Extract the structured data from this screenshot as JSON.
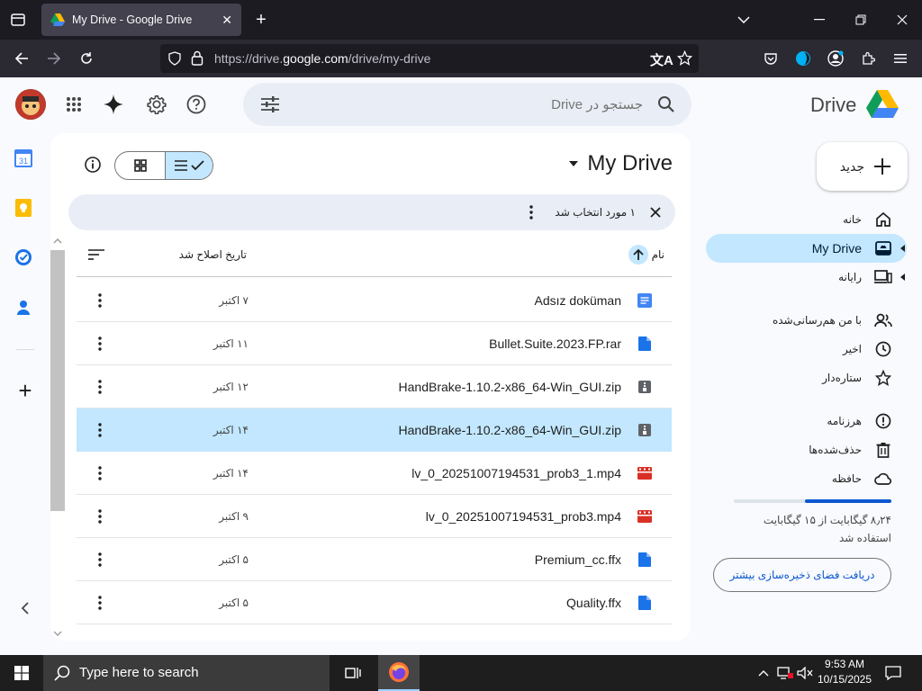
{
  "browser": {
    "tab_title": "My Drive - Google Drive",
    "url_prefix": "https://drive.",
    "url_domain": "google.com",
    "url_path": "/drive/my-drive"
  },
  "drive": {
    "logo_text": "Drive",
    "search_placeholder": "جستجو در Drive",
    "new_button": "جدید",
    "title": "My Drive",
    "selection_text": "۱ مورد انتخاب شد",
    "col_name": "نام",
    "col_modified": "تاریخ اصلاح شد",
    "nav": [
      {
        "label": "خانه",
        "icon": "home-icon"
      },
      {
        "label": "My Drive",
        "icon": "my-drive-icon"
      },
      {
        "label": "رایانه",
        "icon": "computer-icon"
      },
      {
        "label": "با من هم‌رسانی‌شده",
        "icon": "shared-icon"
      },
      {
        "label": "اخیر",
        "icon": "recent-icon"
      },
      {
        "label": "ستاره‌دار",
        "icon": "star-icon"
      },
      {
        "label": "هرزنامه",
        "icon": "spam-icon"
      },
      {
        "label": "حذف‌شده‌ها",
        "icon": "trash-icon"
      },
      {
        "label": "حافظه",
        "icon": "cloud-icon"
      }
    ],
    "storage_text": "۸٫۲۴ گیگابایت از ۱۵ گیگابایت استفاده شد",
    "storage_used_fraction": 0.55,
    "storage_button": "دریافت فضای ذخیره‌سازی بیشتر",
    "files": [
      {
        "name": "Adsız doküman",
        "date": "۷ اکتبر",
        "type": "doc"
      },
      {
        "name": "Bullet.Suite.2023.FP.rar",
        "date": "۱۱ اکتبر",
        "type": "file"
      },
      {
        "name": "HandBrake-1.10.2-x86_64-Win_GUI.zip",
        "date": "۱۲ اکتبر",
        "type": "zip"
      },
      {
        "name": "HandBrake-1.10.2-x86_64-Win_GUI.zip",
        "date": "۱۴ اکتبر",
        "type": "zip",
        "selected": true
      },
      {
        "name": "lv_0_20251007194531_prob3_1.mp4",
        "date": "۱۴ اکتبر",
        "type": "video"
      },
      {
        "name": "lv_0_20251007194531_prob3.mp4",
        "date": "۹ اکتبر",
        "type": "video"
      },
      {
        "name": "Premium_cc.ffx",
        "date": "۵ اکتبر",
        "type": "file"
      },
      {
        "name": "Quality.ffx",
        "date": "۵ اکتبر",
        "type": "file"
      }
    ]
  },
  "taskbar": {
    "search_placeholder": "Type here to search",
    "time": "9:53 AM",
    "date": "10/15/2025"
  },
  "colors": {
    "accent": "#0b57d0",
    "selected_row": "#c2e7ff",
    "nav_active": "#c2e7ff",
    "video_red": "#d93025",
    "doc_blue": "#4285f4",
    "firefox_tab": "#42414d"
  }
}
